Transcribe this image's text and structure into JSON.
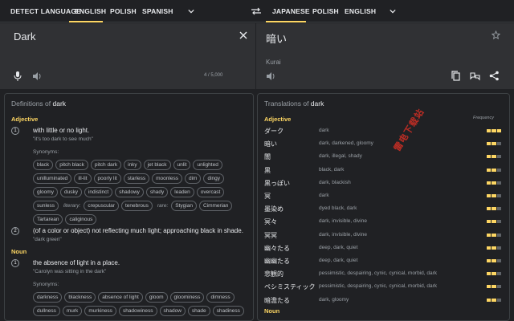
{
  "source_langs": [
    "DETECT LANGUAGE",
    "ENGLISH",
    "POLISH",
    "SPANISH"
  ],
  "target_langs": [
    "JAPANESE",
    "POLISH",
    "ENGLISH"
  ],
  "source": {
    "text": "Dark",
    "count": "4 / 5,000"
  },
  "target": {
    "text": "暗い",
    "romanization": "Kurai"
  },
  "definitions": {
    "title_prefix": "Definitions of ",
    "word": "dark",
    "adjective_label": "Adjective",
    "noun_label": "Noun",
    "synonyms_label": "Synonyms:",
    "adj_defs": [
      {
        "num": "1",
        "text": "with little or no light.",
        "example": "\"it's too dark to see much\""
      },
      {
        "num": "2",
        "text": "(of a color or object) not reflecting much light; approaching black in shade.",
        "example": "\"dark green\""
      }
    ],
    "adj_synonyms": [
      "black",
      "pitch black",
      "pitch dark",
      "inky",
      "jet black",
      "unlit",
      "unlighted",
      "unilluminated",
      "ill-lit",
      "poorly lit",
      "starless",
      "moonless",
      "dim",
      "dingy",
      "gloomy",
      "dusky",
      "indistinct",
      "shadowy",
      "shady",
      "leaden",
      "overcast",
      "sunless"
    ],
    "literary_label": "literary:",
    "literary_synonyms": [
      "crepuscular",
      "tenebrous"
    ],
    "rare_label": "rare:",
    "rare_synonyms": [
      "Stygian",
      "Cimmerian",
      "Tartarean",
      "caliginous"
    ],
    "noun_defs": [
      {
        "num": "1",
        "text": "the absence of light in a place.",
        "example": "\"Carolyn was sitting in the dark\""
      }
    ],
    "noun_synonyms": [
      "darkness",
      "blackness",
      "absence of light",
      "gloom",
      "gloominess",
      "dimness",
      "dullness",
      "murk",
      "murkiness",
      "shadowiness",
      "shadow",
      "shade",
      "shadiness"
    ]
  },
  "translations": {
    "title_prefix": "Translations of ",
    "word": "dark",
    "adjective_label": "Adjective",
    "noun_label": "Noun",
    "frequency_label": "Frequency",
    "watermark": "雷电下载站",
    "rows": [
      {
        "word": "ダーク",
        "syn": "dark",
        "freq": 3
      },
      {
        "word": "暗い",
        "syn": "dark, darkened, gloomy",
        "freq": 2
      },
      {
        "word": "闇",
        "syn": "dark, illegal, shady",
        "freq": 2
      },
      {
        "word": "黒",
        "syn": "black, dark",
        "freq": 2
      },
      {
        "word": "黒っぽい",
        "syn": "dark, blackish",
        "freq": 2
      },
      {
        "word": "冥",
        "syn": "dark",
        "freq": 2
      },
      {
        "word": "墨染め",
        "syn": "dyed black, dark",
        "freq": 2
      },
      {
        "word": "冥々",
        "syn": "dark, invisible, divine",
        "freq": 2
      },
      {
        "word": "冥冥",
        "syn": "dark, invisible, divine",
        "freq": 2
      },
      {
        "word": "幽々たる",
        "syn": "deep, dark, quiet",
        "freq": 2
      },
      {
        "word": "幽幽たる",
        "syn": "deep, dark, quiet",
        "freq": 2
      },
      {
        "word": "悲観的",
        "syn": "pessimistic, despairing, cynic, cynical, morbid, dark",
        "freq": 2
      },
      {
        "word": "ペシミスティック",
        "syn": "pessimistic, despairing, cynic, cynical, morbid, dark",
        "freq": 2
      },
      {
        "word": "暗澹たる",
        "syn": "dark, gloomy",
        "freq": 2
      }
    ]
  },
  "icons": [
    "close-icon",
    "star-icon",
    "mic-icon",
    "speaker-icon",
    "copy-icon",
    "feedback-icon",
    "share-icon",
    "swap-icon",
    "chevron-down-icon"
  ],
  "colors": {
    "accent": "#fdd663",
    "background": "#202124",
    "panel": "#303134"
  }
}
